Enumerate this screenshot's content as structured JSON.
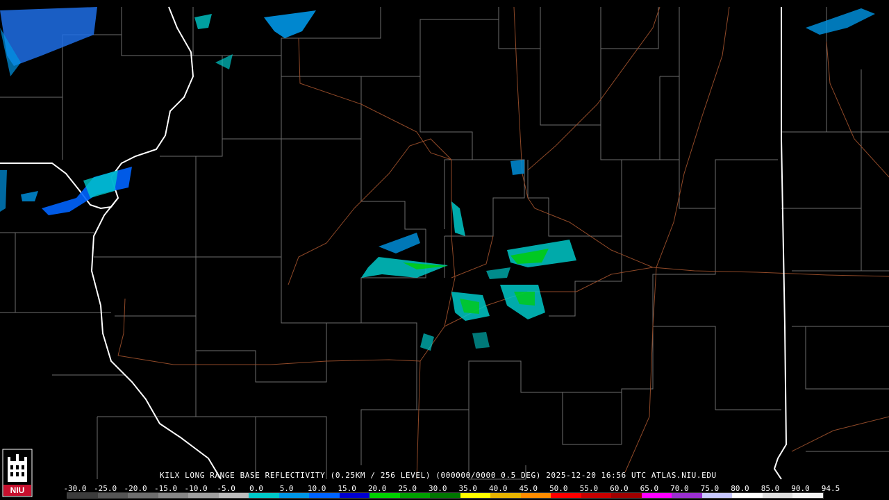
{
  "caption": {
    "station": "KILX",
    "product": "LONG RANGE BASE REFLECTIVITY",
    "resolution": "(0.25KM / 256 LEVEL)",
    "volume": "(000000/0000 0.5 DEG)",
    "datetime": "2025-12-20 16:56 UTC",
    "source": "ATLAS.NIU.EDU"
  },
  "logo": {
    "text": "NIU",
    "icon": "niu-tower-logo-icon",
    "color": "#c8102e"
  },
  "scale": {
    "labels": [
      "-30.0",
      "-25.0",
      "-20.0",
      "-15.0",
      "-10.0",
      "-5.0",
      "0.0",
      "5.0",
      "10.0",
      "15.0",
      "20.0",
      "25.0",
      "30.0",
      "35.0",
      "40.0",
      "45.0",
      "50.0",
      "55.0",
      "60.0",
      "65.0",
      "70.0",
      "75.0",
      "80.0",
      "85.0",
      "90.0",
      "94.5"
    ],
    "colors": [
      "#3c3c3c",
      "#555555",
      "#6e6e6e",
      "#878787",
      "#a0a0a0",
      "#bcbcbc",
      "#00c8c8",
      "#0096e6",
      "#0064ff",
      "#0000d0",
      "#00d000",
      "#00a000",
      "#007800",
      "#ffff00",
      "#e6b400",
      "#ff8c00",
      "#ff0000",
      "#c80000",
      "#a00000",
      "#ff00ff",
      "#9b30d0",
      "#c8c8ff",
      "#ffffff",
      "#e0e0e0",
      "#f4f4f4"
    ]
  },
  "map": {
    "state_border_color": "#ffffff",
    "county_line_color": "#8a8a8a",
    "highway_color": "#a0522d"
  }
}
